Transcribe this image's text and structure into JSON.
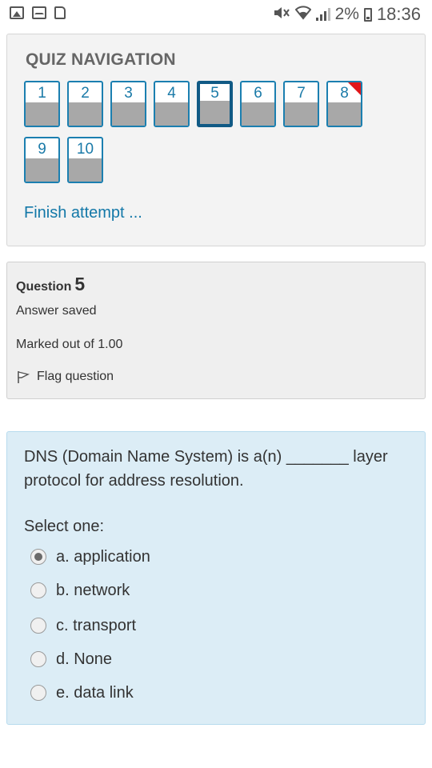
{
  "status_bar": {
    "battery": "2%",
    "time": "18:36",
    "icons": [
      "image-icon",
      "mail-icon",
      "note-icon",
      "mute-icon",
      "wifi-icon",
      "signal-icon",
      "battery-icon"
    ]
  },
  "quiz_navigation": {
    "title": "QUIZ NAVIGATION",
    "buttons": [
      {
        "label": "1",
        "state": "answered"
      },
      {
        "label": "2",
        "state": "answered"
      },
      {
        "label": "3",
        "state": "answered"
      },
      {
        "label": "4",
        "state": "answered"
      },
      {
        "label": "5",
        "state": "current"
      },
      {
        "label": "6",
        "state": "answered"
      },
      {
        "label": "7",
        "state": "answered"
      },
      {
        "label": "8",
        "state": "flagged"
      },
      {
        "label": "9",
        "state": "answered"
      },
      {
        "label": "10",
        "state": "answered"
      }
    ],
    "finish_link": "Finish attempt ..."
  },
  "question_info": {
    "label": "Question",
    "number": "5",
    "state": "Answer saved",
    "grade": "Marked out of 1.00",
    "flag_label": "Flag question"
  },
  "question": {
    "text": "DNS (Domain Name System) is a(n) _______ layer protocol for address resolution.",
    "select_label": "Select one:",
    "options": [
      {
        "label": "a. application",
        "selected": true
      },
      {
        "label": "b. network",
        "selected": false
      },
      {
        "label": "c. transport",
        "selected": false
      },
      {
        "label": "d. None",
        "selected": false
      },
      {
        "label": "e. data link",
        "selected": false
      }
    ]
  },
  "colors": {
    "link": "#1378a8",
    "nav_border": "#1b7fb0",
    "current_border": "#115a85",
    "flag": "#e0161a",
    "question_bg": "#dcedf6"
  }
}
